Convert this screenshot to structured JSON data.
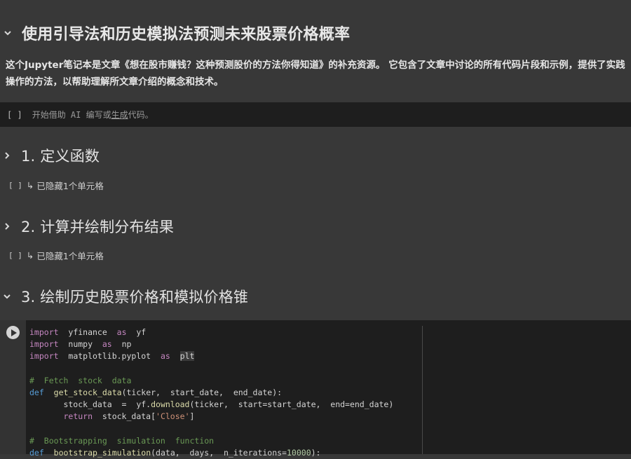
{
  "notebook": {
    "title": "使用引导法和历史模拟法预测未来股票价格概率",
    "intro": "这个Jupyter笔记本是文章《想在股市赚钱？这种预测股价的方法你得知道》的补充资源。 它包含了文章中讨论的所有代码片段和示例，提供了实践操作的方法，以帮助理解所文章介绍的概念和技术。",
    "ai_prompt": {
      "brackets": "[ ]",
      "prefix": "开始借助 AI 编写或",
      "link": "生成",
      "suffix": "代码。"
    },
    "sections": [
      {
        "title": "1. 定义函数",
        "hidden_brackets": "[ ]",
        "hidden_arrow": "↳",
        "hidden_text": "已隐藏1个单元格"
      },
      {
        "title": "2. 计算并绘制分布结果",
        "hidden_brackets": "[ ]",
        "hidden_arrow": "↳",
        "hidden_text": "已隐藏1个单元格"
      },
      {
        "title": "3. 绘制历史股票价格和模拟价格锥"
      }
    ],
    "code_lines": [
      [
        {
          "t": "import",
          "c": "kw"
        },
        {
          "t": "  yfinance  "
        },
        {
          "t": "as",
          "c": "kw"
        },
        {
          "t": "  yf"
        }
      ],
      [
        {
          "t": "import",
          "c": "kw"
        },
        {
          "t": "  numpy  "
        },
        {
          "t": "as",
          "c": "kw"
        },
        {
          "t": "  np"
        }
      ],
      [
        {
          "t": "import",
          "c": "kw"
        },
        {
          "t": "  matplotlib.pyplot  "
        },
        {
          "t": "as",
          "c": "kw"
        },
        {
          "t": "  "
        },
        {
          "t": "plt",
          "c": "hl"
        }
      ],
      [
        {
          "t": ""
        }
      ],
      [
        {
          "t": "#  Fetch  stock  data",
          "c": "cm"
        }
      ],
      [
        {
          "t": "def",
          "c": "def"
        },
        {
          "t": "  "
        },
        {
          "t": "get_stock_data",
          "c": "fn"
        },
        {
          "t": "(ticker,  start_date,  end_date):"
        }
      ],
      [
        {
          "t": "       stock_data  =  yf."
        },
        {
          "t": "download",
          "c": "fn"
        },
        {
          "t": "(ticker,  start=start_date,  end=end_date)"
        }
      ],
      [
        {
          "t": "       "
        },
        {
          "t": "return",
          "c": "kw"
        },
        {
          "t": "  stock_data["
        },
        {
          "t": "'Close'",
          "c": "str"
        },
        {
          "t": "]"
        }
      ],
      [
        {
          "t": ""
        }
      ],
      [
        {
          "t": "#  Bootstrapping  simulation  function",
          "c": "cm"
        }
      ],
      [
        {
          "t": "def",
          "c": "def"
        },
        {
          "t": "  "
        },
        {
          "t": "bootstrap_simulation",
          "c": "fn"
        },
        {
          "t": "(data,  days,  n_iterations="
        },
        {
          "t": "10000",
          "c": "num"
        },
        {
          "t": "):"
        }
      ]
    ]
  }
}
